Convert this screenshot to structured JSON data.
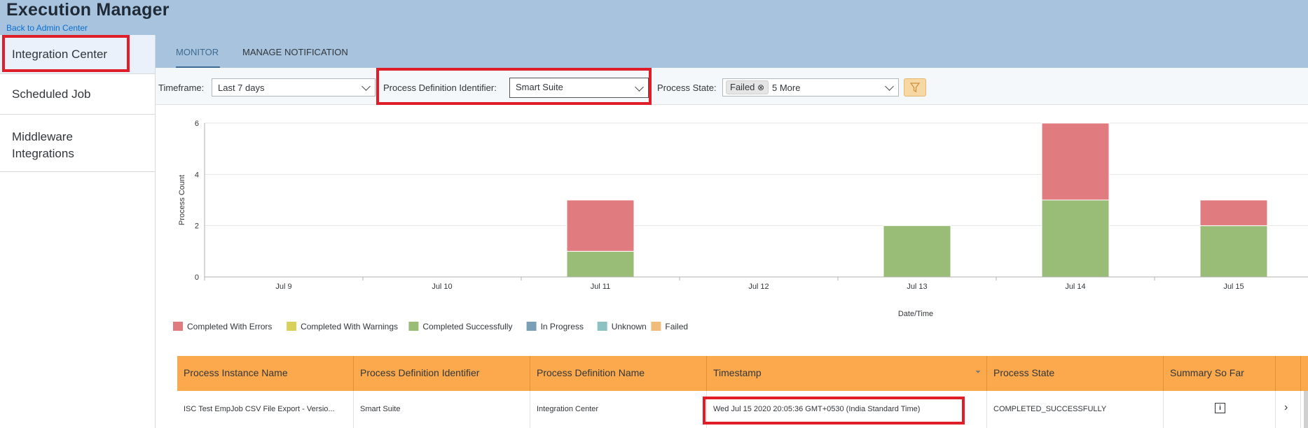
{
  "header": {
    "title": "Execution Manager",
    "back_link": "Back to Admin Center"
  },
  "sidebar": {
    "items": [
      {
        "label": "Integration Center"
      },
      {
        "label": "Scheduled Job"
      },
      {
        "label": "Middleware Integrations"
      }
    ]
  },
  "tabs": [
    {
      "label": "MONITOR",
      "active": true
    },
    {
      "label": "MANAGE NOTIFICATION",
      "active": false
    }
  ],
  "filters": {
    "timeframe_label": "Timeframe:",
    "timeframe_value": "Last 7 days",
    "pdi_label": "Process Definition Identifier:",
    "pdi_value": "Smart Suite",
    "state_label": "Process State:",
    "state_token": "Failed",
    "state_more": "5 More"
  },
  "chart_data": {
    "type": "bar",
    "stacked": true,
    "categories": [
      "Jul 9",
      "Jul 10",
      "Jul 11",
      "Jul 12",
      "Jul 13",
      "Jul 14",
      "Jul 15"
    ],
    "series": [
      {
        "name": "Completed With Errors",
        "color": "#e07b80",
        "values": [
          0,
          0,
          2,
          0,
          0,
          3,
          1
        ]
      },
      {
        "name": "Completed With Warnings",
        "color": "#d9cf5b",
        "values": [
          0,
          0,
          0,
          0,
          0,
          0,
          0
        ]
      },
      {
        "name": "Completed Successfully",
        "color": "#99bd77",
        "values": [
          0,
          0,
          1,
          0,
          2,
          3,
          2
        ]
      },
      {
        "name": "In Progress",
        "color": "#7aa0b7",
        "values": [
          0,
          0,
          0,
          0,
          0,
          0,
          0
        ]
      },
      {
        "name": "Unknown",
        "color": "#8cc3c2",
        "values": [
          0,
          0,
          0,
          0,
          0,
          0,
          0
        ]
      },
      {
        "name": "Failed",
        "color": "#f0bc7c",
        "values": [
          0,
          0,
          0,
          0,
          0,
          0,
          0
        ]
      }
    ],
    "xlabel": "Date/Time",
    "ylabel": "Process Count",
    "ylim": [
      0,
      6
    ],
    "yticks": [
      0,
      2,
      4,
      6
    ],
    "grid": true,
    "legend_position": "bottom-left"
  },
  "table": {
    "columns": [
      "Process Instance Name",
      "Process Definition Identifier",
      "Process Definition Name",
      "Timestamp",
      "Process State",
      "Summary So Far"
    ],
    "rows": [
      [
        "ISC Test EmpJob CSV File Export - Versio...",
        "Smart Suite",
        "Integration Center",
        "Wed Jul 15 2020 20:05:36 GMT+0530 (India Standard Time)",
        "COMPLETED_SUCCESSFULLY",
        ""
      ]
    ]
  }
}
